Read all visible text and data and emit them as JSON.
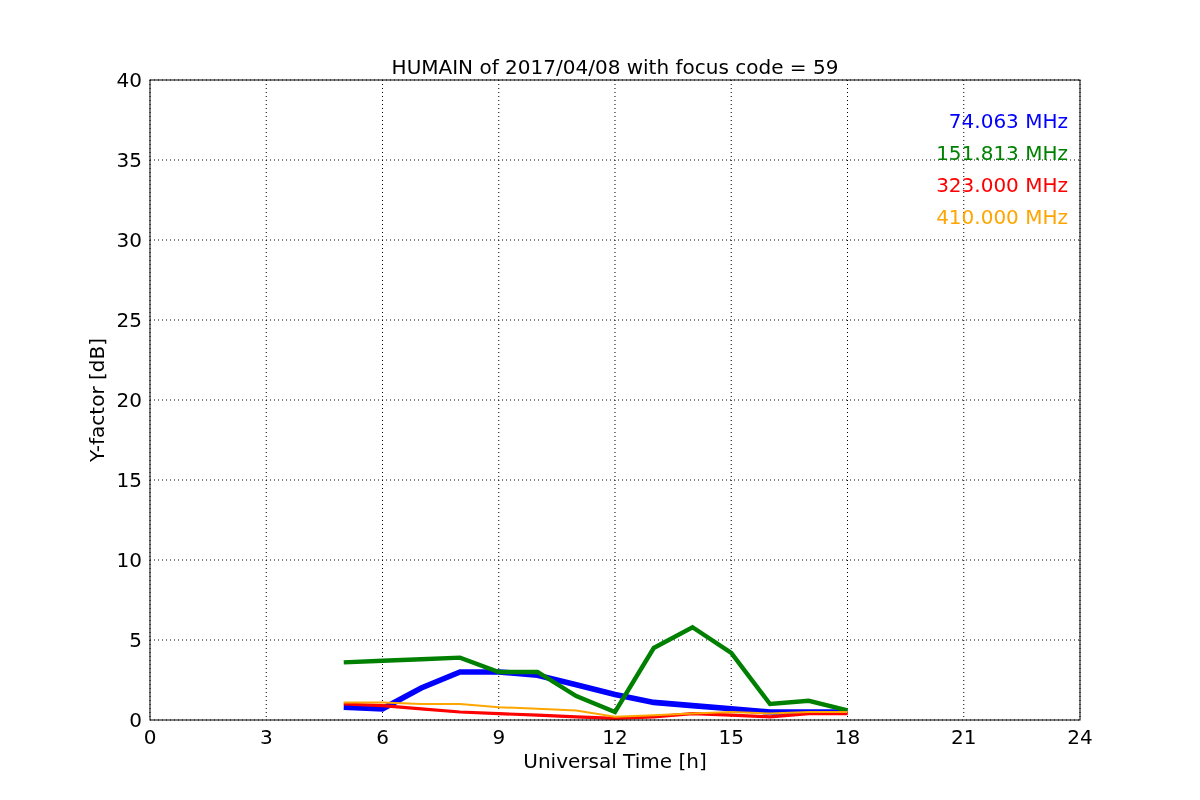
{
  "chart_data": {
    "type": "line",
    "title": "HUMAIN of 2017/04/08 with focus code = 59",
    "xlabel": "Universal Time [h]",
    "ylabel": "Y-factor [dB]",
    "x": [
      5,
      6,
      7,
      8,
      9,
      10,
      11,
      12,
      13,
      14,
      15,
      16,
      17,
      18
    ],
    "xlim": [
      0,
      24
    ],
    "ylim": [
      0,
      40
    ],
    "xticks": [
      0,
      3,
      6,
      9,
      12,
      15,
      18,
      21,
      24
    ],
    "yticks": [
      0,
      5,
      10,
      15,
      20,
      25,
      30,
      35,
      40
    ],
    "grid": true,
    "series": [
      {
        "name": "74.063 MHz",
        "color": "#0000ff",
        "values": [
          0.8,
          0.7,
          2.0,
          3.0,
          3.0,
          2.8,
          2.2,
          1.6,
          1.1,
          0.9,
          0.7,
          0.5,
          0.5,
          0.5
        ]
      },
      {
        "name": "151.813 MHz",
        "color": "#008000",
        "values": [
          3.6,
          3.7,
          3.8,
          3.9,
          3.0,
          3.0,
          1.5,
          0.5,
          4.5,
          5.8,
          4.2,
          1.0,
          1.2,
          0.6
        ]
      },
      {
        "name": "323.000 MHz",
        "color": "#ff0000",
        "values": [
          1.0,
          0.9,
          0.7,
          0.5,
          0.4,
          0.3,
          0.2,
          0.1,
          0.2,
          0.4,
          0.3,
          0.2,
          0.4,
          0.4
        ]
      },
      {
        "name": "410.000 MHz",
        "color": "#ffa500",
        "values": [
          1.1,
          1.1,
          1.0,
          1.0,
          0.8,
          0.7,
          0.6,
          0.2,
          0.3,
          0.4,
          0.5,
          0.4,
          0.5,
          0.5
        ]
      }
    ]
  }
}
